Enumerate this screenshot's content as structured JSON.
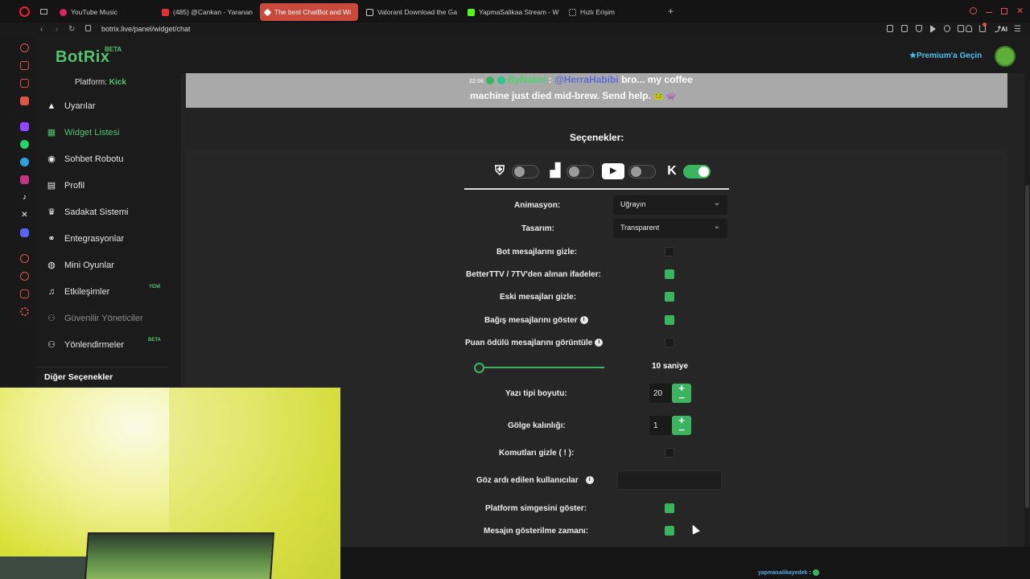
{
  "browser": {
    "tabs": [
      {
        "label": "YouTube Music",
        "color": "#e0245e"
      },
      {
        "label": "(485) @Cankan - Yaranan",
        "color": "#e03030"
      },
      {
        "label": "The best ChatBot and Wi",
        "color": "#ffffff"
      },
      {
        "label": "Valorant Download the Ga",
        "color": "#cfcfcf"
      },
      {
        "label": "YapmaSalikaa Stream - W",
        "color": "#53fc18"
      },
      {
        "label": "Hızlı Erişim",
        "color": "#cfcfcf"
      }
    ],
    "new_tab": "+",
    "url": "botrix.live/panel/widget/chat",
    "ai_label": "AI"
  },
  "brand": {
    "name": "BotRix",
    "badge": "BETA",
    "accent": "#53c46f"
  },
  "header": {
    "premium": "★Premium'a Geçin"
  },
  "sidebar": {
    "platform_label": "Platform:",
    "platform_value": "Kick",
    "items": [
      {
        "label": "Uyarılar",
        "icon": "warning-icon"
      },
      {
        "label": "Widget Listesi",
        "icon": "grid-icon"
      },
      {
        "label": "Sohbet Robotu",
        "icon": "robot-icon"
      },
      {
        "label": "Profil",
        "icon": "id-card-icon"
      },
      {
        "label": "Sadakat Sistemi",
        "icon": "trophy-icon"
      },
      {
        "label": "Entegrasyonlar",
        "icon": "plug-icon"
      },
      {
        "label": "Mini Oyunlar",
        "icon": "gamepad-icon"
      },
      {
        "label": "Etkileşimler",
        "icon": "music-icon",
        "badge": "YENİ"
      },
      {
        "label": "Güvenilir Yöneticiler",
        "icon": "users-icon"
      },
      {
        "label": "Yönlendirmeler",
        "icon": "group-icon",
        "badge": "BETA"
      }
    ],
    "other_options": "Diğer Seçenekler"
  },
  "preview": {
    "time": "22:06",
    "user": "ByNakel",
    "sep": ":",
    "mention": "@HerraHabibi",
    "text1": "bro... my coffee",
    "text2": "machine just died mid-brew. Send help.",
    "emotes": "🐸 👾"
  },
  "options": {
    "title": "Seçenekler:",
    "platforms": [
      {
        "name": "kick-alt-icon",
        "on": false
      },
      {
        "name": "twitch-icon",
        "on": false
      },
      {
        "name": "youtube-icon",
        "on": false
      },
      {
        "name": "kick-icon",
        "on": true
      }
    ],
    "animation": {
      "label": "Animasyon:",
      "value": "Uğrayın"
    },
    "design": {
      "label": "Tasarım:",
      "value": "Transparent"
    },
    "hide_bot": {
      "label": "Bot mesajlarını gizle:",
      "checked": false
    },
    "bttv": {
      "label": "BetterTTV / 7TV'den alınan ifadeler:",
      "checked": true
    },
    "hide_old": {
      "label": "Eski mesajları gizle:",
      "checked": true
    },
    "donations": {
      "label": "Bağış mesajlarını göster",
      "checked": true
    },
    "points": {
      "label": "Puan ödülü mesajlarını görüntüle",
      "checked": false
    },
    "duration": {
      "value": "10 saniye",
      "fraction": 0.03
    },
    "font_size": {
      "label": "Yazı tipi boyutu:",
      "value": "20"
    },
    "shadow": {
      "label": "Gölge kalınlığı:",
      "value": "1"
    },
    "hide_commands": {
      "label": "Komutları gizle ( ! ):",
      "checked": false
    },
    "ignored_users": {
      "label": "Göz ardı edilen kullanıcılar",
      "value": ""
    },
    "platform_icon": {
      "label": "Platform simgesini göster:",
      "checked": true
    },
    "msg_time": {
      "label": "Mesajın gösterilme zamanı:",
      "checked": true
    }
  },
  "footer": {
    "user": "yapmasalikayedek",
    "sep": ":"
  }
}
